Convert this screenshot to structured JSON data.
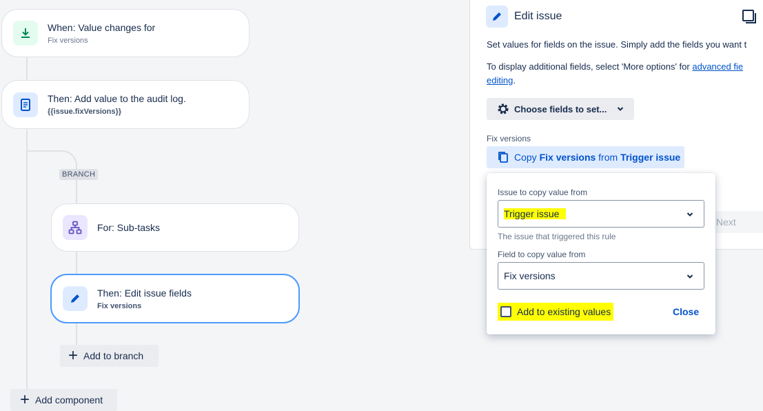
{
  "rule": {
    "trigger": {
      "title": "When: Value changes for",
      "subtitle": "Fix versions"
    },
    "audit": {
      "title": "Then: Add value to the audit log.",
      "subtitle": "{{issue.fixVersions}}"
    },
    "branch_tag": "BRANCH",
    "for_subtasks": {
      "title": "For: Sub-tasks"
    },
    "edit_fields": {
      "title": "Then: Edit issue fields",
      "subtitle": "Fix versions"
    },
    "add_to_branch": "Add to branch",
    "add_component": "Add component"
  },
  "panel": {
    "title": "Edit issue",
    "description": "Set values for fields on the issue. Simply add the fields you want t",
    "more_prefix": "To display additional fields, select 'More options' for",
    "more_link": "advanced fie",
    "more_link_line2": "editing",
    "more_suffix": ".",
    "choose_fields": "Choose fields to set...",
    "field_label": "Fix versions",
    "copy_prefix": "Copy",
    "copy_field": "Fix versions",
    "copy_middle": "from",
    "copy_source": "Trigger issue",
    "next": "Next"
  },
  "popup": {
    "issue_label": "Issue to copy value from",
    "issue_value": "Trigger issue",
    "issue_helper": "The issue that triggered this rule",
    "field_label": "Field to copy value from",
    "field_value": "Fix versions",
    "checkbox_label": "Add to existing values",
    "checkbox_checked": false,
    "close": "Close",
    "highlight_color": "#ffff00"
  }
}
